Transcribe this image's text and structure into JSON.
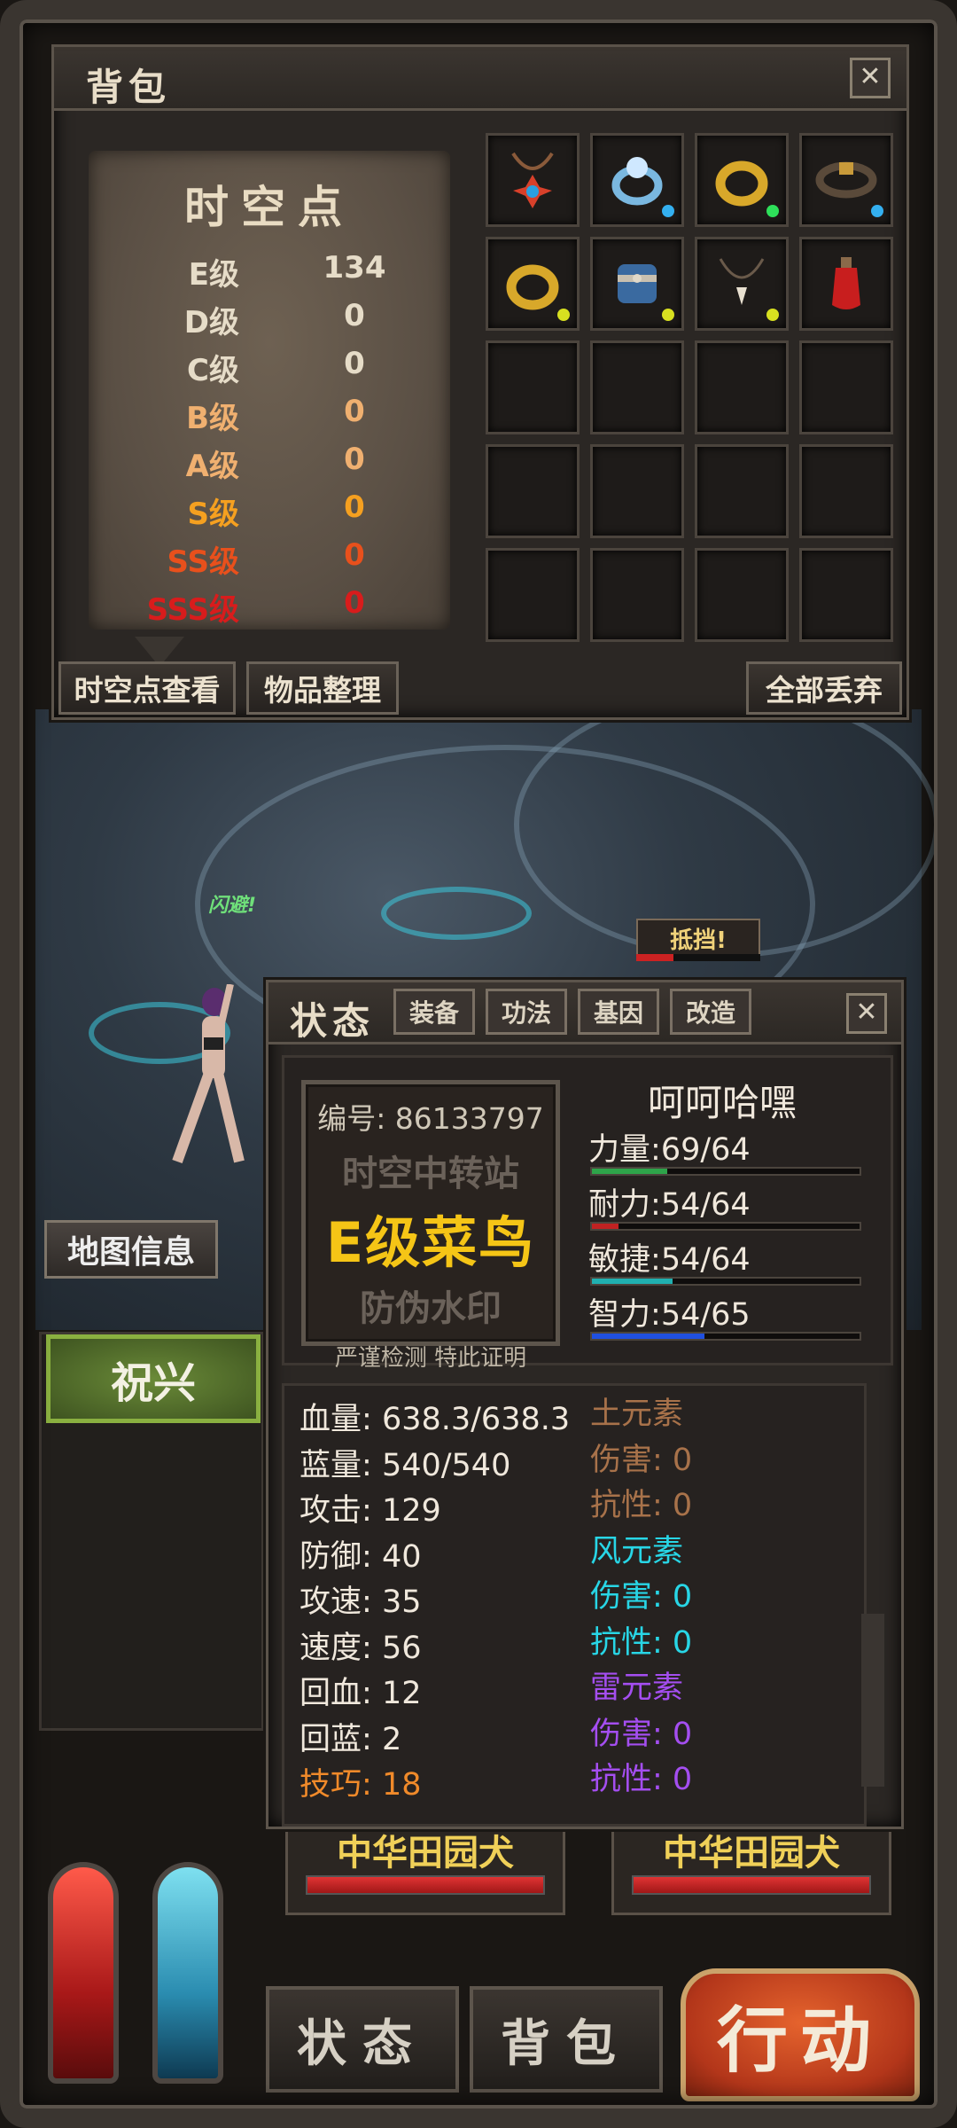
{
  "bag": {
    "title": "背包",
    "close": "✕",
    "spacetime": {
      "title": "时空点",
      "grades": [
        {
          "grade": "E级",
          "value": "134",
          "color": "#e6dcc8"
        },
        {
          "grade": "D级",
          "value": "0",
          "color": "#e6dcc8"
        },
        {
          "grade": "C级",
          "value": "0",
          "color": "#e6dcc8"
        },
        {
          "grade": "B级",
          "value": "0",
          "color": "#f0b070"
        },
        {
          "grade": "A级",
          "value": "0",
          "color": "#f0b070"
        },
        {
          "grade": "S级",
          "value": "0",
          "color": "#f5a020"
        },
        {
          "grade": "SS级",
          "value": "0",
          "color": "#e8501c"
        },
        {
          "grade": "SSS级",
          "value": "0",
          "color": "#d81c1c"
        }
      ]
    },
    "items": [
      {
        "icon": "amulet-icon",
        "dot": ""
      },
      {
        "icon": "blue-ring-icon",
        "dot": "#34b0f0"
      },
      {
        "icon": "gold-ring-icon",
        "dot": "#2ee05a"
      },
      {
        "icon": "belt-icon",
        "dot": "#34b0f0"
      },
      {
        "icon": "gold-ring-icon",
        "dot": "#d8e020"
      },
      {
        "icon": "bracer-icon",
        "dot": "#d8e020"
      },
      {
        "icon": "tooth-necklace-icon",
        "dot": "#d8e020"
      },
      {
        "icon": "red-potion-icon",
        "dot": ""
      }
    ],
    "buttons": {
      "view_points": "时空点查看",
      "sort_items": "物品整理",
      "discard_all": "全部丢弃"
    }
  },
  "scene": {
    "dodge_text": "闪避!",
    "block_text": "抵挡!",
    "map_info": "地图信息"
  },
  "status": {
    "title": "状态",
    "tabs": [
      "装备",
      "功法",
      "基因",
      "改造"
    ],
    "close": "✕",
    "stamp": {
      "number": "编号: 86133797",
      "line1": "时空中转站",
      "line2": "E级菜鸟",
      "line3": "防伪水印",
      "line4": "严谨检测 特此证明"
    },
    "char_name": "呵呵哈嘿",
    "attributes": [
      {
        "label": "力量",
        "value": "69/64",
        "fill": 0.28,
        "color": "#2ea44a"
      },
      {
        "label": "耐力",
        "value": "54/64",
        "fill": 0.1,
        "color": "#c02222"
      },
      {
        "label": "敏捷",
        "value": "54/64",
        "fill": 0.3,
        "color": "#20b0b0"
      },
      {
        "label": "智力",
        "value": "54/65",
        "fill": 0.42,
        "color": "#2050e0"
      }
    ],
    "stats": [
      {
        "label": "血量",
        "value": "638.3/638.3"
      },
      {
        "label": "蓝量",
        "value": "540/540"
      },
      {
        "label": "攻击",
        "value": "129"
      },
      {
        "label": "防御",
        "value": "40"
      },
      {
        "label": "攻速",
        "value": "35"
      },
      {
        "label": "速度",
        "value": "56"
      },
      {
        "label": "回血",
        "value": "12"
      },
      {
        "label": "回蓝",
        "value": "2"
      },
      {
        "label": "技巧",
        "value": "18"
      }
    ],
    "elements": [
      {
        "text": "土元素",
        "color": "#a8724a"
      },
      {
        "text": "伤害: 0",
        "color": "#a8724a"
      },
      {
        "text": "抗性: 0",
        "color": "#a8724a"
      },
      {
        "text": "风元素",
        "color": "#28d6e6"
      },
      {
        "text": "伤害: 0",
        "color": "#28d6e6"
      },
      {
        "text": "抗性: 0",
        "color": "#28d6e6"
      },
      {
        "text": "雷元素",
        "color": "#a44ef0"
      },
      {
        "text": "伤害: 0",
        "color": "#a44ef0"
      },
      {
        "text": "抗性: 0",
        "color": "#a44ef0"
      }
    ]
  },
  "party": {
    "member": "祝兴",
    "enemies": [
      {
        "name": "中华田园犬",
        "hp": 1.0
      },
      {
        "name": "中华田园犬",
        "hp": 1.0
      }
    ]
  },
  "bottom": {
    "status_btn": "状态",
    "bag_btn": "背包",
    "action_btn": "行动"
  }
}
